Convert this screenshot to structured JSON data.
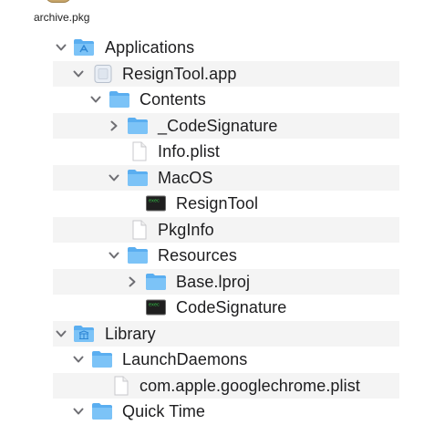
{
  "package": {
    "caption": "archive.pkg",
    "icon": "package-icon"
  },
  "tree": [
    {
      "label": "Applications",
      "icon": "folder-applications-icon",
      "expanded": true
    },
    {
      "label": "ResignTool.app",
      "icon": "app-bundle-icon",
      "expanded": true
    },
    {
      "label": "Contents",
      "icon": "folder-icon",
      "expanded": true
    },
    {
      "label": "_CodeSignature",
      "icon": "folder-icon",
      "expanded": false
    },
    {
      "label": "Info.plist",
      "icon": "document-icon"
    },
    {
      "label": "MacOS",
      "icon": "folder-icon",
      "expanded": true
    },
    {
      "label": "ResignTool",
      "icon": "terminal-executable-icon"
    },
    {
      "label": "PkgInfo",
      "icon": "document-icon"
    },
    {
      "label": "Resources",
      "icon": "folder-icon",
      "expanded": true
    },
    {
      "label": "Base.lproj",
      "icon": "folder-icon",
      "expanded": false
    },
    {
      "label": "CodeSignature",
      "icon": "terminal-executable-icon"
    },
    {
      "label": "Library",
      "icon": "folder-library-icon",
      "expanded": true
    },
    {
      "label": "LaunchDaemons",
      "icon": "folder-icon",
      "expanded": true
    },
    {
      "label": "com.apple.googlechrome.plist",
      "icon": "document-icon"
    },
    {
      "label": "Quick Time",
      "icon": "folder-icon",
      "expanded": true
    }
  ]
}
